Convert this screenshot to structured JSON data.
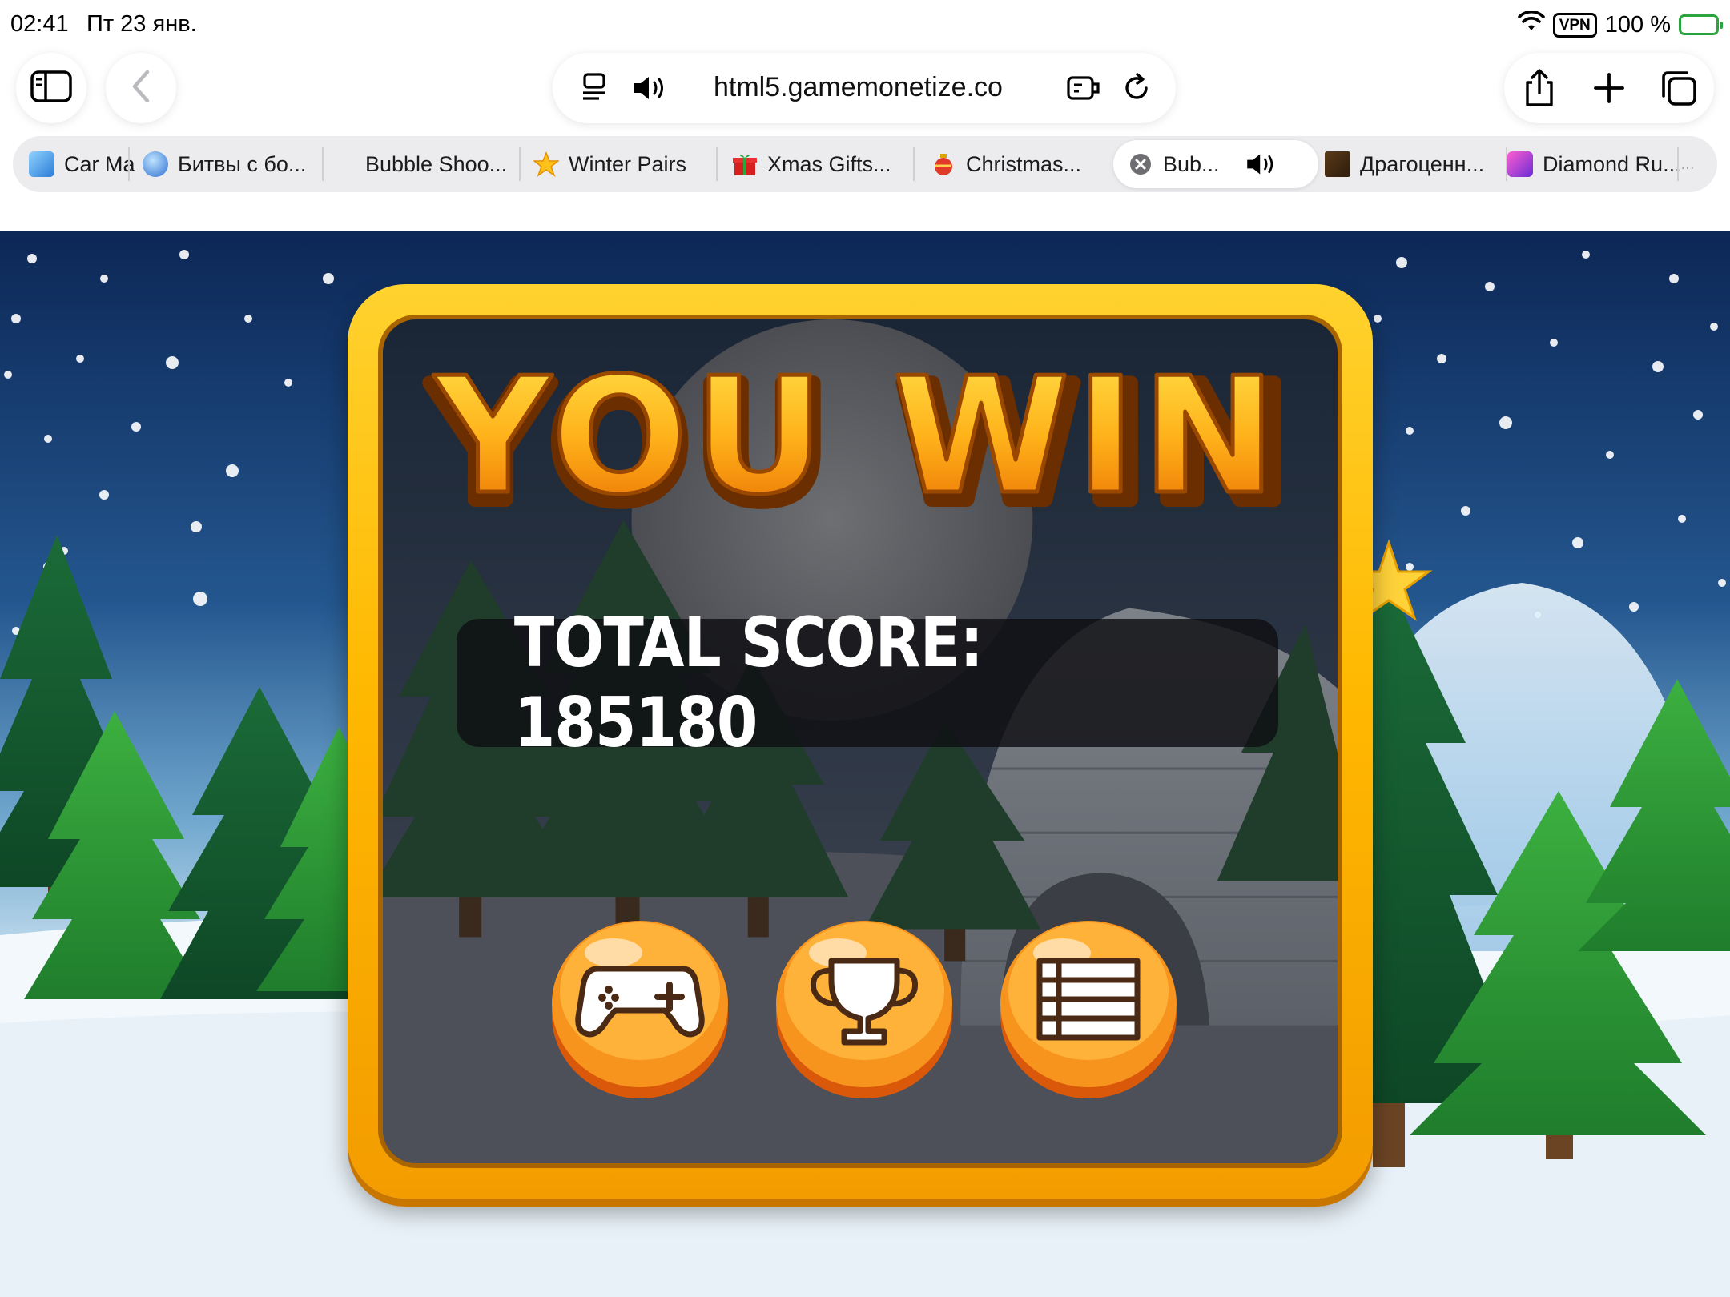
{
  "status_bar": {
    "time": "02:41",
    "date": "Пт 23 янв.",
    "vpn": "VPN",
    "battery": "100 %",
    "battery_level": 1.0
  },
  "toolbar": {
    "address": "html5.gamemonetize.co",
    "icons": [
      "sidebar-icon",
      "back-chevron-icon",
      "reader-icon",
      "speaker-icon",
      "extension-icon",
      "reload-icon",
      "share-icon",
      "plus-icon",
      "tabs-icon"
    ]
  },
  "tabs": [
    {
      "label": "Car Ma"
    },
    {
      "label": "Битвы с бо..."
    },
    {
      "label": "Bubble Shoo..."
    },
    {
      "label": "Winter Pairs"
    },
    {
      "label": "Xmas Gifts..."
    },
    {
      "label": "Christmas..."
    },
    {
      "label": "Bub...",
      "active": true
    },
    {
      "label": "Драгоценн..."
    },
    {
      "label": "Diamond Ru..."
    }
  ],
  "game": {
    "title": "YOU WIN",
    "score_text": "TOTAL SCORE: 185180",
    "buttons": [
      {
        "name": "play",
        "icon": "gamepad-icon"
      },
      {
        "name": "leaderboard",
        "icon": "trophy-icon"
      },
      {
        "name": "menu",
        "icon": "list-icon"
      }
    ],
    "colors": {
      "panel_frame": "#ffb800",
      "button": "#f7941d",
      "sky_top": "#0d2a5c",
      "title": "#ffb21a"
    }
  }
}
